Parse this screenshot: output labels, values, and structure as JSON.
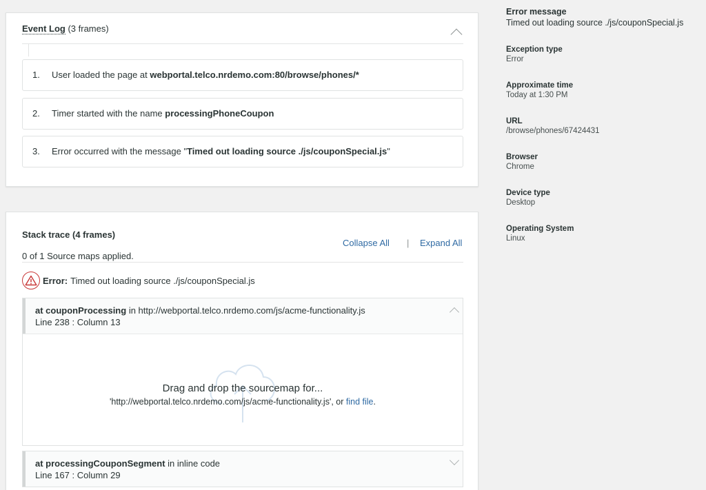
{
  "event_log": {
    "title": "Event Log",
    "count": "(3 frames)",
    "frames": [
      {
        "num": "1.",
        "text": "User loaded the page at ",
        "bold": "webportal.telco.nrdemo.com:80/browse/phones/*",
        "suffix": ""
      },
      {
        "num": "2.",
        "text": "Timer started with the name ",
        "bold": "processingPhoneCoupon",
        "suffix": ""
      },
      {
        "num": "3.",
        "text": "Error occurred with the message \"",
        "bold": "Timed out loading source ./js/couponSpecial.js",
        "suffix": "\""
      }
    ]
  },
  "stack_trace": {
    "title": "Stack trace (4 frames)",
    "collapse_all": "Collapse All",
    "separator": "|",
    "expand_all": "Expand All",
    "source_maps_status": "0 of 1 Source maps applied.",
    "error_label": "Error:",
    "error_message": "Timed out loading source ./js/couponSpecial.js",
    "frames": [
      {
        "function": "at couponProcessing",
        "location": " in http://webportal.telco.nrdemo.com/js/acme-functionality.js",
        "line": "Line 238 : Column 13",
        "drop_title": "Drag and drop the sourcemap for...",
        "drop_sub": "'http://webportal.telco.nrdemo.com/js/acme-functionality.js', or ",
        "find_file": "find file",
        "drop_period": "."
      },
      {
        "function": "at processingCouponSegment",
        "location": " in inline code",
        "line": "Line 167 : Column 29"
      }
    ]
  },
  "sidebar": {
    "error_message": {
      "label": "Error message",
      "value": "Timed out loading source ./js/couponSpecial.js"
    },
    "exception_type": {
      "label": "Exception type",
      "value": "Error"
    },
    "approximate_time": {
      "label": "Approximate time",
      "value": "Today at 1:30 PM"
    },
    "url": {
      "label": "URL",
      "value": "/browse/phones/67424431"
    },
    "browser": {
      "label": "Browser",
      "value": "Chrome"
    },
    "device_type": {
      "label": "Device type",
      "value": "Desktop"
    },
    "operating_system": {
      "label": "Operating System",
      "value": "Linux"
    }
  },
  "colors": {
    "link": "#2f6aa3",
    "error_red": "#c83737",
    "background": "#f1f1f1",
    "panel": "#ffffff"
  },
  "icons": [
    "chevron-up-icon",
    "chevron-down-icon",
    "warning-icon",
    "cloud-upload-icon"
  ]
}
